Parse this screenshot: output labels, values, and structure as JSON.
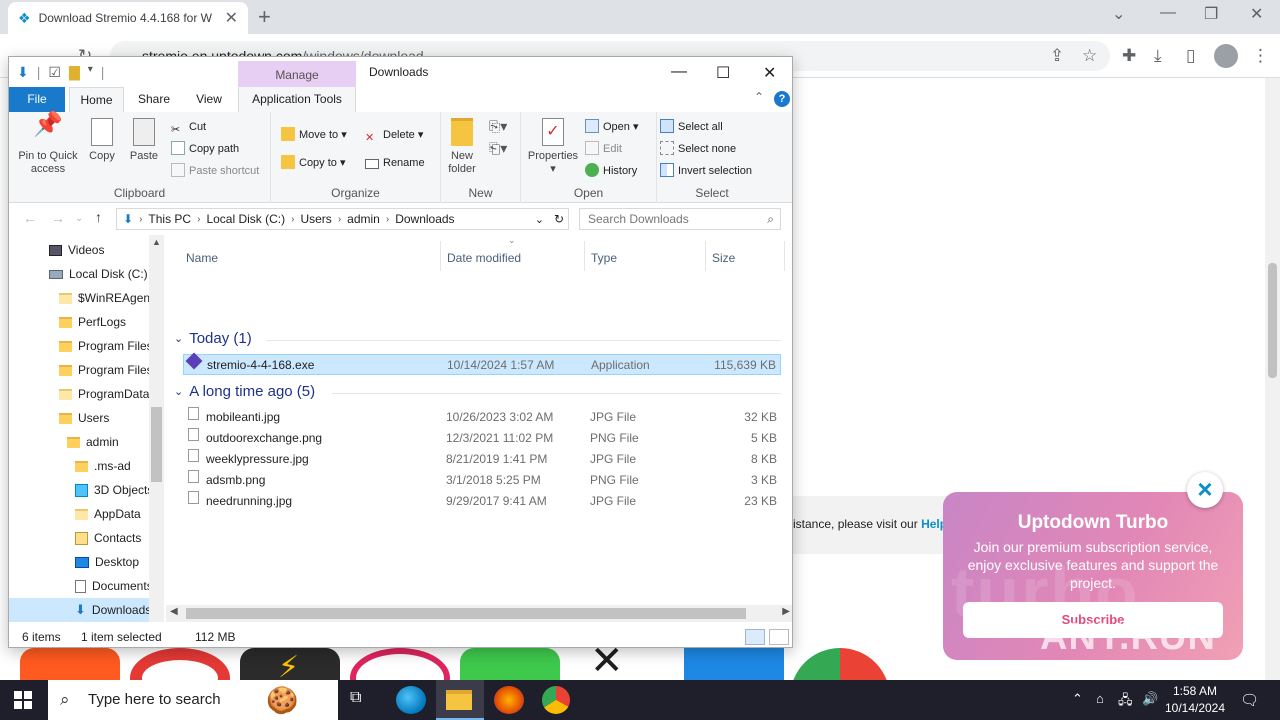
{
  "browser": {
    "tab_title": "Download Stremio 4.4.168 for W",
    "url_host": "stremio.en.uptodown.com",
    "url_path": "/windows/download",
    "icons": [
      "back-icon",
      "forward-icon",
      "reload-icon",
      "share-icon",
      "star-icon",
      "extensions-icon",
      "download-icon",
      "sidepanel-icon",
      "profile-icon",
      "menu-icon"
    ]
  },
  "site": {
    "help_text": "istance, please visit our ",
    "help_link": "Help",
    "promo": {
      "title": "Uptodown Turbo",
      "body": "Join our premium subscription service, enjoy exclusive features and support the project.",
      "button": "Subscribe",
      "bg_word": "turbo"
    },
    "watermark": "ANY.RUN"
  },
  "explorer": {
    "title": "Downloads",
    "context_tab": "Manage",
    "context_subtab": "Application Tools",
    "menu": {
      "file": "File",
      "home": "Home",
      "share": "Share",
      "view": "View"
    },
    "ribbon": {
      "clipboard": {
        "label": "Clipboard",
        "pin": "Pin to Quick access",
        "copy": "Copy",
        "paste": "Paste",
        "cut": "Cut",
        "copy_path": "Copy path",
        "paste_shortcut": "Paste shortcut"
      },
      "organize": {
        "label": "Organize",
        "move_to": "Move to",
        "copy_to": "Copy to",
        "delete": "Delete",
        "rename": "Rename"
      },
      "new": {
        "label": "New",
        "new_folder": "New folder"
      },
      "open": {
        "label": "Open",
        "properties": "Properties",
        "open": "Open",
        "edit": "Edit",
        "history": "History"
      },
      "select": {
        "label": "Select",
        "select_all": "Select all",
        "select_none": "Select none",
        "invert": "Invert selection"
      }
    },
    "breadcrumb": [
      "This PC",
      "Local Disk (C:)",
      "Users",
      "admin",
      "Downloads"
    ],
    "search_placeholder": "Search Downloads",
    "tree": [
      {
        "label": "Videos",
        "icon": "videos-icon"
      },
      {
        "label": "Local Disk (C:)",
        "icon": "disk-icon"
      },
      {
        "label": "$WinREAgent",
        "icon": "folder-icon"
      },
      {
        "label": "PerfLogs",
        "icon": "folder-icon"
      },
      {
        "label": "Program Files",
        "icon": "folder-icon"
      },
      {
        "label": "Program Files",
        "icon": "folder-icon"
      },
      {
        "label": "ProgramData",
        "icon": "folder-icon"
      },
      {
        "label": "Users",
        "icon": "folder-icon"
      },
      {
        "label": "admin",
        "icon": "folder-icon"
      },
      {
        "label": ".ms-ad",
        "icon": "folder-icon"
      },
      {
        "label": "3D Objects",
        "icon": "3d-objects-icon"
      },
      {
        "label": "AppData",
        "icon": "folder-icon"
      },
      {
        "label": "Contacts",
        "icon": "contacts-icon"
      },
      {
        "label": "Desktop",
        "icon": "desktop-icon"
      },
      {
        "label": "Documents",
        "icon": "documents-icon"
      },
      {
        "label": "Downloads",
        "icon": "downloads-icon"
      }
    ],
    "columns": {
      "name": "Name",
      "date": "Date modified",
      "type": "Type",
      "size": "Size"
    },
    "groups": [
      {
        "header": "Today (1)",
        "files": [
          {
            "name": "stremio-4-4-168.exe",
            "date": "10/14/2024 1:57 AM",
            "type": "Application",
            "size": "115,639 KB"
          }
        ]
      },
      {
        "header": "A long time ago (5)",
        "files": [
          {
            "name": "mobileanti.jpg",
            "date": "10/26/2023 3:02 AM",
            "type": "JPG File",
            "size": "32 KB"
          },
          {
            "name": "outdoorexchange.png",
            "date": "12/3/2021 11:02 PM",
            "type": "PNG File",
            "size": "5 KB"
          },
          {
            "name": "weeklypressure.jpg",
            "date": "8/21/2019 1:41 PM",
            "type": "JPG File",
            "size": "8 KB"
          },
          {
            "name": "adsmb.png",
            "date": "3/1/2018 5:25 PM",
            "type": "PNG File",
            "size": "3 KB"
          },
          {
            "name": "needrunning.jpg",
            "date": "9/29/2017 9:41 AM",
            "type": "JPG File",
            "size": "23 KB"
          }
        ]
      }
    ],
    "status": {
      "items": "6 items",
      "selected": "1 item selected",
      "size": "112 MB"
    }
  },
  "taskbar": {
    "search_placeholder": "Type here to search",
    "time": "1:58 AM",
    "date": "10/14/2024"
  },
  "colors": {
    "accent": "#1979ca",
    "selection": "#cce8ff",
    "promo": "#e287b6"
  }
}
